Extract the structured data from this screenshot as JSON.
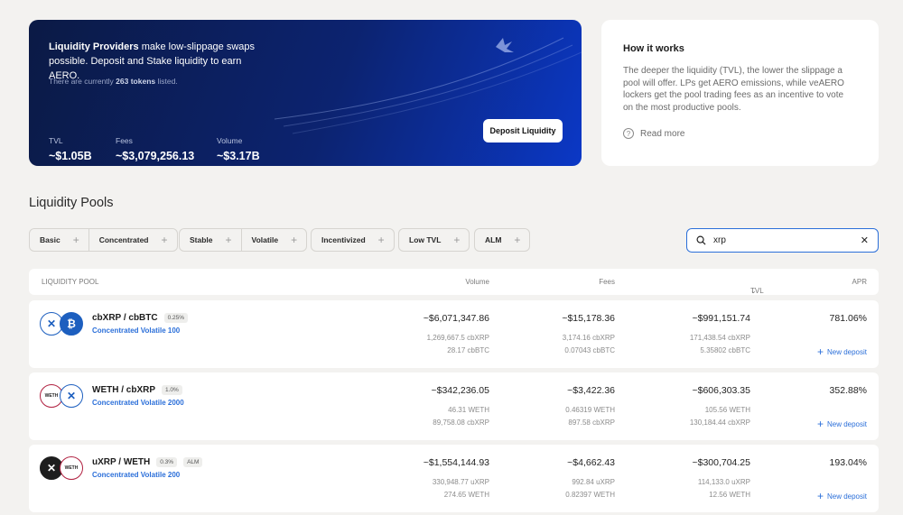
{
  "hero": {
    "intro_bold": "Liquidity Providers",
    "intro_rest": " make low-slippage swaps possible. Deposit and Stake liquidity to earn AERO.",
    "count_prefix": "There are currently ",
    "count_value": "263 tokens",
    "count_suffix": " listed.",
    "stats": [
      {
        "label": "TVL",
        "value": "~$1.05B"
      },
      {
        "label": "Fees",
        "value": "~$3,079,256.13"
      },
      {
        "label": "Volume",
        "value": "~$3.17B"
      }
    ],
    "deposit_label": "Deposit Liquidity"
  },
  "how": {
    "title": "How it works",
    "text": "The deeper the liquidity (TVL), the lower the slippage a pool will offer. LPs get AERO emissions, while veAERO lockers get the pool trading fees as an incentive to vote on the most productive pools.",
    "read_more": "Read more",
    "icon": "question-icon"
  },
  "section_title": "Liquidity Pools",
  "filters": {
    "basic": "Basic",
    "concentrated": "Concentrated",
    "stable": "Stable",
    "volatile": "Volatile",
    "incentivized": "Incentivized",
    "low_tvl": "Low TVL",
    "alm": "ALM"
  },
  "search": {
    "value": "xrp",
    "icon": "search-icon"
  },
  "table": {
    "headers": {
      "pool": "LIQUIDITY POOL",
      "volume": "Volume",
      "fees": "Fees",
      "tvl": "TVL",
      "apr": "APR"
    },
    "new_deposit": "New deposit",
    "rows": [
      {
        "pair": "cbXRP / cbBTC",
        "fee": "0.25%",
        "alm": "",
        "type": "Concentrated Volatile 100",
        "coin_a": "✕",
        "coin_b": "₿",
        "volume": "~$6,071,347.86",
        "volume_a": "1,269,667.5",
        "volume_a_sym": "cbXRP",
        "volume_b": "28.17",
        "volume_b_sym": "cbBTC",
        "fees": "~$15,178.36",
        "fees_a": "3,174.16",
        "fees_a_sym": "cbXRP",
        "fees_b": "0.07043",
        "fees_b_sym": "cbBTC",
        "tvl": "~$991,151.74",
        "tvl_a": "171,438.54",
        "tvl_a_sym": "cbXRP",
        "tvl_b": "5.35802",
        "tvl_b_sym": "cbBTC",
        "apr": "781.06%"
      },
      {
        "pair": "WETH / cbXRP",
        "fee": "1.0%",
        "alm": "",
        "type": "Concentrated Volatile 2000",
        "coin_a": "WETH",
        "coin_b": "✕",
        "volume": "~$342,236.05",
        "volume_a": "46.31",
        "volume_a_sym": "WETH",
        "volume_b": "89,758.08",
        "volume_b_sym": "cbXRP",
        "fees": "~$3,422.36",
        "fees_a": "0.46319",
        "fees_a_sym": "WETH",
        "fees_b": "897.58",
        "fees_b_sym": "cbXRP",
        "tvl": "~$606,303.35",
        "tvl_a": "105.56",
        "tvl_a_sym": "WETH",
        "tvl_b": "130,184.44",
        "tvl_b_sym": "cbXRP",
        "apr": "352.88%"
      },
      {
        "pair": "uXRP / WETH",
        "fee": "0.3%",
        "alm": "ALM",
        "type": "Concentrated Volatile 200",
        "coin_a": "✕",
        "coin_b": "WETH",
        "volume": "~$1,554,144.93",
        "volume_a": "330,948.77",
        "volume_a_sym": "uXRP",
        "volume_b": "274.65",
        "volume_b_sym": "WETH",
        "fees": "~$4,662.43",
        "fees_a": "992.84",
        "fees_a_sym": "uXRP",
        "fees_b": "0.82397",
        "fees_b_sym": "WETH",
        "tvl": "~$300,704.25",
        "tvl_a": "114,133.0",
        "tvl_a_sym": "uXRP",
        "tvl_b": "12.56",
        "tvl_b_sym": "WETH",
        "apr": "193.04%"
      }
    ]
  }
}
